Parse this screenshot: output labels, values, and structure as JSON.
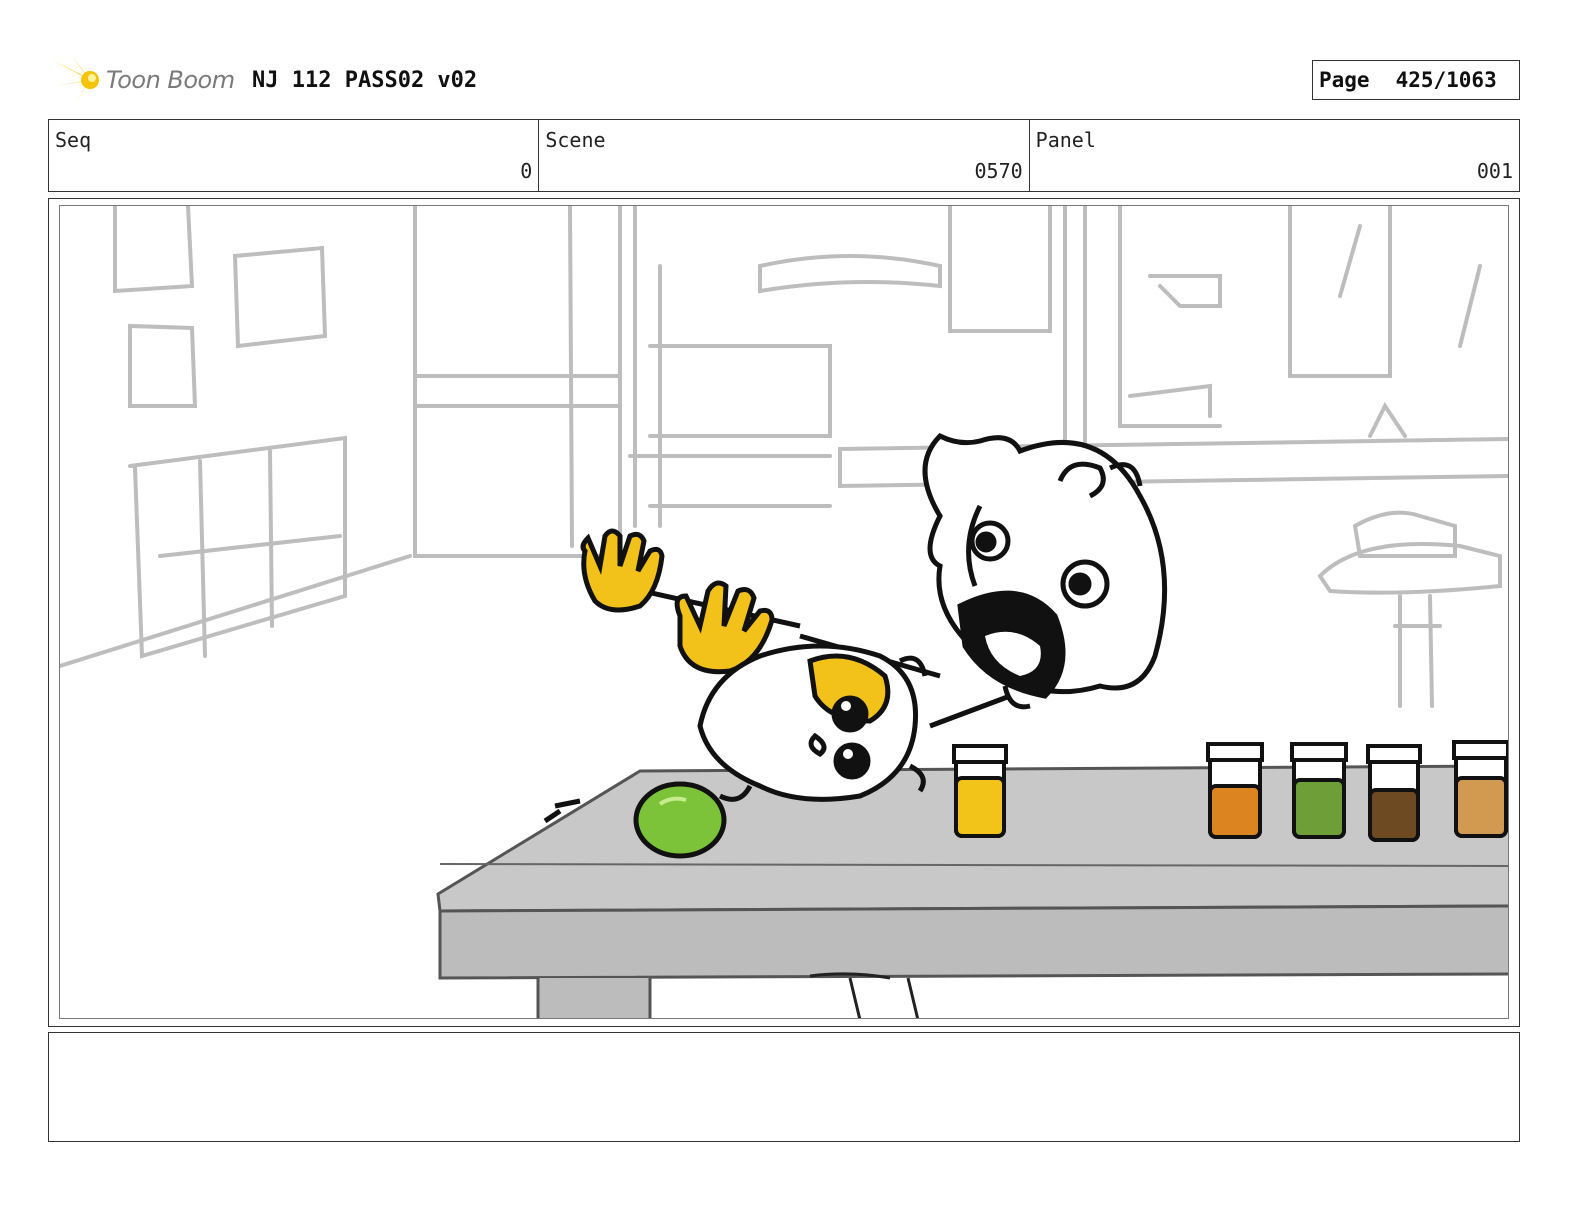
{
  "header": {
    "logo_text": "Toon Boom",
    "title": "NJ 112 PASS02 v02",
    "page_label": "Page",
    "page_value": "425/1063"
  },
  "meta": {
    "seq_label": "Seq",
    "seq_value": "0",
    "scene_label": "Scene",
    "scene_value": "0570",
    "panel_label": "Panel",
    "panel_value": "001"
  },
  "notes": {
    "text": ""
  },
  "colors": {
    "logo_yellow": "#f5c400",
    "hand_yellow": "#f2c21b",
    "table_gray": "#c8c8c8",
    "lime_green": "#7cc33a",
    "jar_yellow": "#f2c318",
    "jar_orange": "#dc8420",
    "jar_green": "#6e9e38",
    "jar_brown": "#6e4a22",
    "jar_tan": "#d19a50"
  },
  "icons": {
    "logo": "toon-boom-star-icon"
  }
}
